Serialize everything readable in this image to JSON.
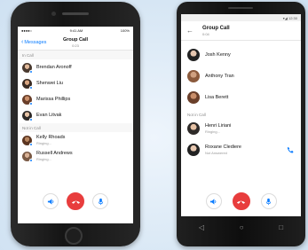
{
  "colors": {
    "accent": "#0a7cff",
    "end_call": "#e83d3d",
    "background": "#dce9f6"
  },
  "iphone": {
    "status_left": "●●●●○",
    "status_time": "9:41 AM",
    "status_right": "100%",
    "back_label": "Messages",
    "title": "Group Call",
    "subtitle": "0:23",
    "in_call_header": "In Call",
    "in_call": [
      {
        "name": "Brendan Aronoff",
        "badge": true
      },
      {
        "name": "Shenwei Liu",
        "badge": true
      },
      {
        "name": "Marissa Phillips",
        "badge": true
      },
      {
        "name": "Evan Litvak",
        "badge": true
      }
    ],
    "not_in_call_header": "Not in Call",
    "not_in_call": [
      {
        "name": "Kelly Rhoads",
        "status": "Ringing..."
      },
      {
        "name": "Russell Andrews",
        "status": "Ringing..."
      }
    ],
    "controls": [
      "speaker-icon",
      "end-call-icon",
      "microphone-icon"
    ]
  },
  "android": {
    "status_right": "▾◢ 12:30",
    "title": "Group Call",
    "subtitle": "0:04",
    "in_call": [
      {
        "name": "Josh Kenny"
      },
      {
        "name": "Anthony Tran"
      },
      {
        "name": "Lisa Berett"
      }
    ],
    "not_in_call_header": "Not in Call",
    "not_in_call": [
      {
        "name": "Henri Liriani",
        "status": "Ringing..."
      },
      {
        "name": "Roxane Clediere",
        "status": "Not Answered"
      }
    ],
    "controls": [
      "speaker-icon",
      "end-call-icon",
      "microphone-icon"
    ],
    "nav": [
      "back-icon",
      "home-icon",
      "recents-icon"
    ]
  }
}
